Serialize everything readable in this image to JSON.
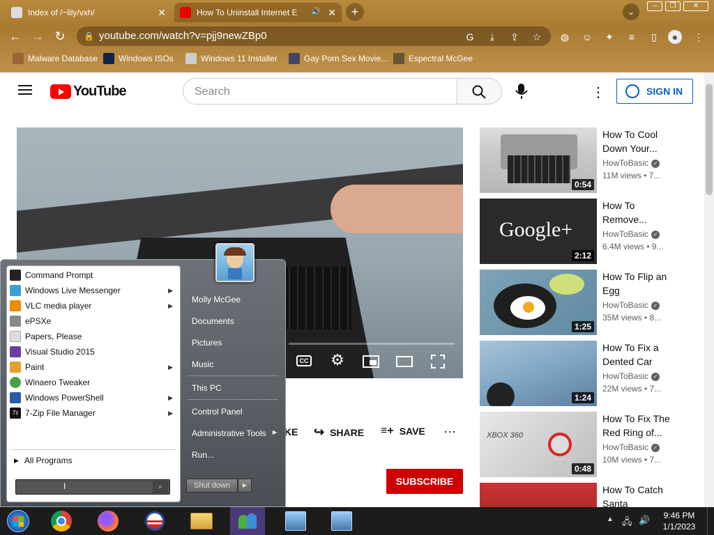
{
  "browser": {
    "tabs": [
      {
        "title": "Index of /~lily/vxh/"
      },
      {
        "title": "How To Uninstall Internet E"
      }
    ],
    "url": "youtube.com/watch?v=pjj9newZBp0",
    "bookmarks": [
      "Malware Database",
      "Windows ISOs",
      "Windows 11 Installer",
      "Gay Porn Sex Movie...",
      "Espectral McGee"
    ]
  },
  "youtube": {
    "logo_text": "YouTube",
    "search_placeholder": "Search",
    "sign_in": "SIGN IN",
    "actions": {
      "like_partial": "KE",
      "share": "SHARE",
      "save": "SAVE"
    },
    "subscribe": "SUBSCRIBE",
    "sidebar": [
      {
        "title": "How To Cool Down Your...",
        "channel": "HowToBasic",
        "stats": "11M views • 7...",
        "duration": "0:54"
      },
      {
        "title": "How To Remove...",
        "channel": "HowToBasic",
        "stats": "6.4M views • 9...",
        "duration": "2:12",
        "thumb_text": "Google+"
      },
      {
        "title": "How To Flip an Egg",
        "channel": "HowToBasic",
        "stats": "35M views • 8...",
        "duration": "1:25"
      },
      {
        "title": "How To Fix a Dented Car",
        "channel": "HowToBasic",
        "stats": "22M views • 7...",
        "duration": "1:24"
      },
      {
        "title": "How To Fix The Red Ring of...",
        "channel": "HowToBasic",
        "stats": "10M views • 7...",
        "duration": "0:48",
        "thumb_text": "XBOX 360"
      },
      {
        "title": "How To Catch Santa",
        "channel": "",
        "stats": "",
        "duration": ""
      }
    ]
  },
  "start_menu": {
    "programs": [
      {
        "label": "Command Prompt",
        "submenu": false,
        "color": "#222222"
      },
      {
        "label": "Windows Live Messenger",
        "submenu": true,
        "color": "#3aa0d8"
      },
      {
        "label": "VLC media player",
        "submenu": true,
        "color": "#f08a00"
      },
      {
        "label": "ePSXe",
        "submenu": false,
        "color": "#888888"
      },
      {
        "label": "Papers, Please",
        "submenu": false,
        "color": "#dddddd"
      },
      {
        "label": "Visual Studio 2015",
        "submenu": false,
        "color": "#6a3fa0"
      },
      {
        "label": "Paint",
        "submenu": true,
        "color": "#e0a030"
      },
      {
        "label": "Winaero Tweaker",
        "submenu": false,
        "color": "#4aa040"
      },
      {
        "label": "Windows PowerShell",
        "submenu": true,
        "color": "#2a5aa8"
      },
      {
        "label": "7-Zip File Manager",
        "submenu": true,
        "color": "#111111"
      }
    ],
    "all_programs": "All Programs",
    "right_items": [
      "Molly McGee",
      "Documents",
      "Pictures",
      "Music",
      "This PC",
      "Control Panel",
      "Administrative Tools",
      "Run..."
    ],
    "shutdown": "Shut down"
  },
  "taskbar": {
    "time": "9:46 PM",
    "date": "1/1/2023"
  }
}
